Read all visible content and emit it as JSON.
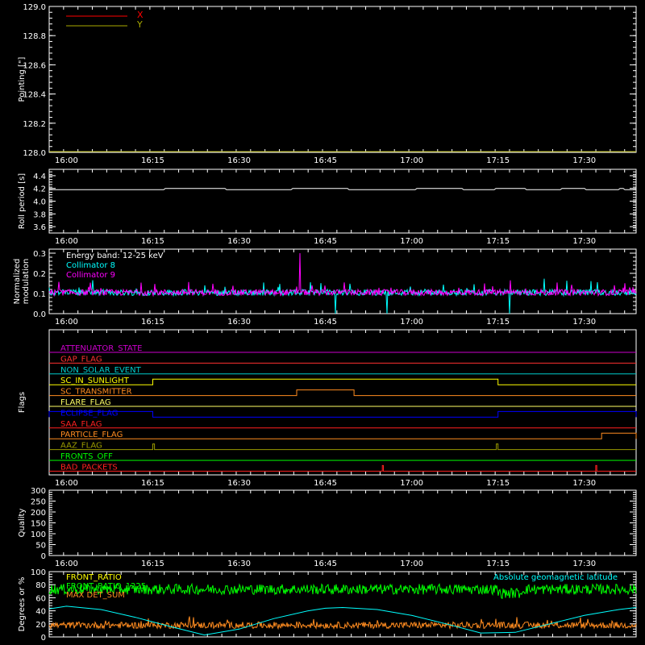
{
  "chart_data": [
    {
      "type": "line",
      "ylabel": "Pointing [\"]",
      "ylim": [
        128.0,
        129.0
      ],
      "yticks": [
        "128.0",
        "128.2",
        "128.4",
        "128.6",
        "128.8",
        "129.0"
      ],
      "xticks": [
        "16:00",
        "16:15",
        "16:30",
        "16:45",
        "17:00",
        "17:15",
        "17:30"
      ],
      "legend": [
        {
          "name": "X",
          "color": "#ff0000"
        },
        {
          "name": "Y",
          "color": "#aaaa00"
        }
      ],
      "series": [
        {
          "name": "X",
          "color": "#ff0000",
          "values": []
        },
        {
          "name": "Y",
          "color": "#aaaa00",
          "values": [
            128.0,
            128.0
          ]
        }
      ]
    },
    {
      "type": "line",
      "ylabel": "Roll period [s]",
      "ylim": [
        3.5,
        4.5
      ],
      "yticks": [
        "3.6",
        "3.8",
        "4.0",
        "4.2",
        "4.4"
      ],
      "xticks": [
        "16:00",
        "16:15",
        "16:30",
        "16:45",
        "17:00",
        "17:15",
        "17:30"
      ],
      "series": [
        {
          "name": "",
          "color": "#ffffff",
          "values": [
            4.18,
            4.18
          ],
          "noise": 0.02
        }
      ]
    },
    {
      "type": "line",
      "ylabel": "Normalized modulation",
      "ylim": [
        0.0,
        0.32
      ],
      "yticks": [
        "0.0",
        "0.1",
        "0.2",
        "0.3"
      ],
      "xticks": [
        "16:00",
        "16:15",
        "16:30",
        "16:45",
        "17:00",
        "17:15",
        "17:30"
      ],
      "legend": [
        {
          "name": "Energy band: 12-25 keV",
          "color": "#ffffff"
        },
        {
          "name": "Collimator 8",
          "color": "#00ffff"
        },
        {
          "name": "Collimator 9",
          "color": "#ff00ff"
        }
      ],
      "series": [
        {
          "name": "Collimator 8",
          "color": "#00ffff",
          "base": 0.105,
          "noise": 0.03
        },
        {
          "name": "Collimator 9",
          "color": "#ff00ff",
          "base": 0.105,
          "noise": 0.03
        }
      ]
    },
    {
      "type": "flags",
      "ylabel": "Flags",
      "xticks": [
        "16:00",
        "16:15",
        "16:30",
        "16:45",
        "17:00",
        "17:15",
        "17:30"
      ],
      "flags": [
        {
          "name": "ATTENUATOR_STATE",
          "color": "#cc00cc",
          "on": []
        },
        {
          "name": "GAP_FLAG",
          "color": "#ff3030",
          "on": []
        },
        {
          "name": "NON_SOLAR_EVENT",
          "color": "#00cccc",
          "on": []
        },
        {
          "name": "SC_IN_SUNLIGHT",
          "color": "#ffff00",
          "on": [
            [
              16.25,
              17.25
            ]
          ]
        },
        {
          "name": "SC_TRANSMITTER",
          "color": "#ff8c20",
          "on": [
            [
              16.667,
              16.833
            ]
          ]
        },
        {
          "name": "FLARE_FLAG",
          "color": "#ffff66",
          "on": []
        },
        {
          "name": "ECLIPSE_FLAG",
          "color": "#0000ff",
          "on": [
            [
              15.95,
              16.25
            ],
            [
              17.25,
              17.65
            ]
          ]
        },
        {
          "name": "SAA_FLAG",
          "color": "#ff2020",
          "on": []
        },
        {
          "name": "PARTICLE_FLAG",
          "color": "#ff8c20",
          "on": [
            [
              17.55,
              17.65
            ]
          ]
        },
        {
          "name": "AAZ_FLAG",
          "color": "#999900",
          "on": [
            [
              16.25,
              16.255
            ],
            [
              17.245,
              17.25
            ]
          ]
        },
        {
          "name": "FRONTS_OFF",
          "color": "#00ff00",
          "on": []
        },
        {
          "name": "BAD_PACKETS",
          "color": "#ff2020",
          "on": [
            [
              16.915,
              16.918
            ],
            [
              17.533,
              17.536
            ]
          ]
        }
      ]
    },
    {
      "type": "line",
      "ylabel": "Quality",
      "ylim": [
        0,
        300
      ],
      "yticks": [
        "0",
        "50",
        "100",
        "150",
        "200",
        "250",
        "300"
      ],
      "xticks": [
        "16:00",
        "16:15",
        "16:30",
        "16:45",
        "17:00",
        "17:15",
        "17:30"
      ],
      "series": []
    },
    {
      "type": "line",
      "ylabel": "Degrees or %",
      "ylim": [
        0,
        100
      ],
      "yticks": [
        "0",
        "20",
        "40",
        "60",
        "80",
        "100"
      ],
      "legend": [
        {
          "name": "FRONT_RATIO",
          "color": "#ffff00"
        },
        {
          "name": "FRONT_RATIO_1225",
          "color": "#00ff00"
        },
        {
          "name": "MAX DET_SUM",
          "color": "#ff8c20"
        },
        {
          "name": "Absolute geomagnetic latitude",
          "color": "#00ffff"
        }
      ],
      "series": [
        {
          "name": "FRONT_RATIO_1225",
          "color": "#00ff00",
          "base": 73,
          "noise": 8
        },
        {
          "name": "MAX DET_SUM",
          "color": "#ff8c20",
          "base": 18,
          "noise": 5
        },
        {
          "name": "Absolute geomagnetic latitude",
          "color": "#00ffff",
          "x": [
            15.95,
            16.0,
            16.1,
            16.2,
            16.3,
            16.4,
            16.5,
            16.6,
            16.7,
            16.75,
            16.8,
            16.9,
            17.0,
            17.1,
            17.2,
            17.3,
            17.4,
            17.5,
            17.6,
            17.65
          ],
          "values": [
            43,
            47,
            42,
            30,
            16,
            3,
            12,
            28,
            40,
            44,
            45,
            42,
            33,
            20,
            6,
            7,
            20,
            33,
            42,
            45
          ]
        }
      ]
    }
  ]
}
